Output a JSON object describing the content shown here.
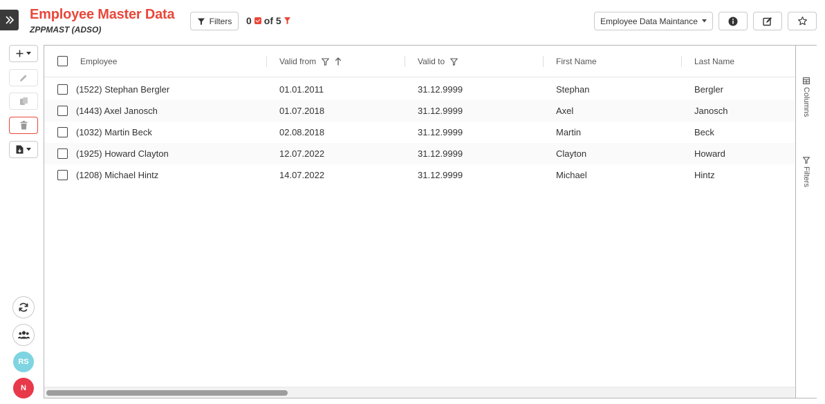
{
  "header": {
    "title": "Employee Master Data",
    "subtitle": "ZPPMAST (ADSO)",
    "filters_label": "Filters",
    "selected_count": "0",
    "of_total": "of 5",
    "variant_label": "Employee Data Maintance"
  },
  "table": {
    "columns": [
      "Employee",
      "Valid from",
      "Valid to",
      "First Name",
      "Last Name"
    ],
    "rows": [
      [
        "(1522) Stephan Bergler",
        "01.01.2011",
        "31.12.9999",
        "Stephan",
        "Bergler"
      ],
      [
        "(1443) Axel Janosch",
        "01.07.2018",
        "31.12.9999",
        "Axel",
        "Janosch"
      ],
      [
        "(1032) Martin Beck",
        "02.08.2018",
        "31.12.9999",
        "Martin",
        "Beck"
      ],
      [
        "(1925) Howard Clayton",
        "12.07.2022",
        "31.12.9999",
        "Clayton",
        "Howard"
      ],
      [
        "(1208) Michael Hintz",
        "14.07.2022",
        "31.12.9999",
        "Michael",
        "Hintz"
      ]
    ]
  },
  "side_panel": {
    "columns_label": "Columns",
    "filters_label": "Filters"
  },
  "users": {
    "avatar1": "RS",
    "avatar2": "N"
  },
  "colors": {
    "accent": "#e8473a",
    "avatar1": "#7ed4e0",
    "avatar2": "#e8394a"
  }
}
